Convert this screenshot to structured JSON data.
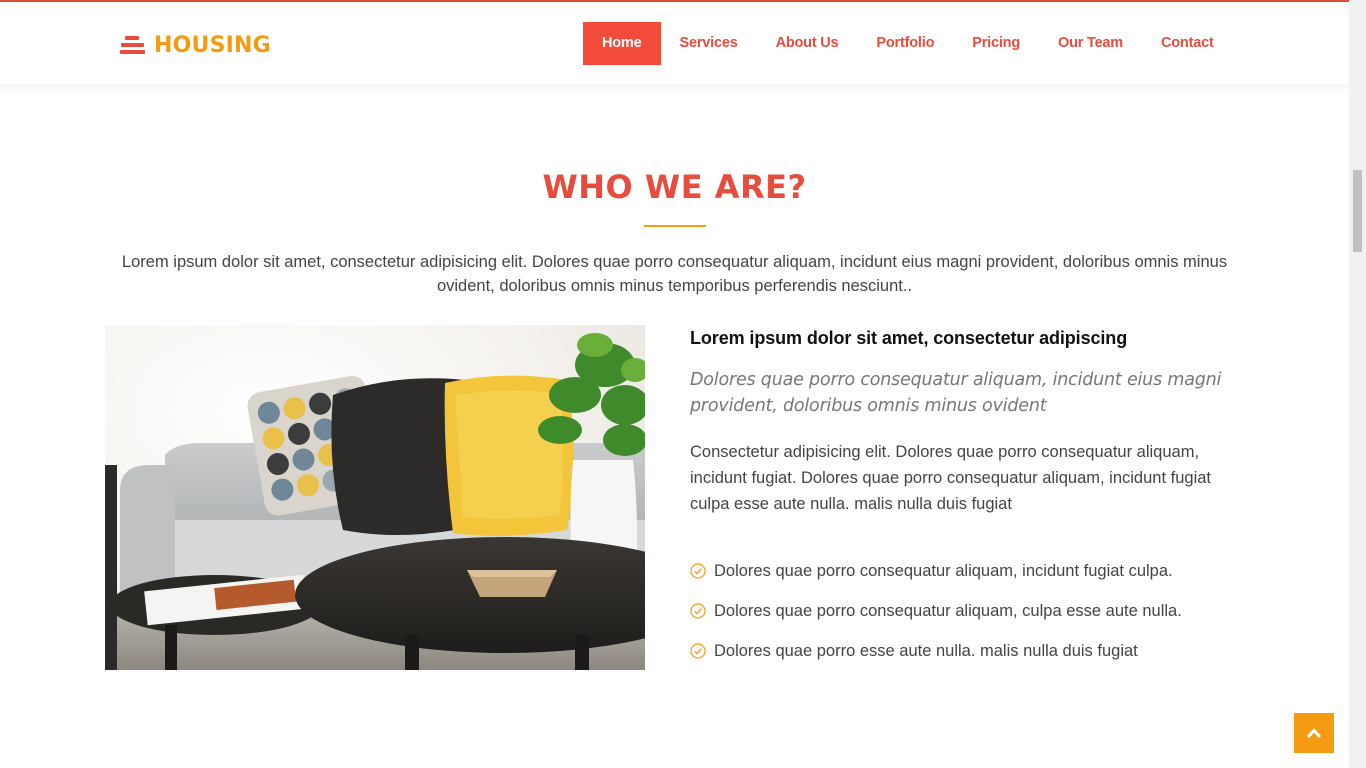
{
  "header": {
    "logo_text": "HOUSING",
    "nav": [
      {
        "label": "Home",
        "active": true
      },
      {
        "label": "Services"
      },
      {
        "label": "About Us"
      },
      {
        "label": "Portfolio"
      },
      {
        "label": "Pricing"
      },
      {
        "label": "Our Team"
      },
      {
        "label": "Contact"
      }
    ]
  },
  "about": {
    "title": "WHO WE ARE?",
    "intro": "Lorem ipsum dolor sit amet, consectetur adipisicing elit. Dolores quae porro consequatur aliquam, incidunt eius magni provident, doloribus omnis minus ovident, doloribus omnis minus temporibus perferendis nesciunt..",
    "heading": "Lorem ipsum dolor sit amet, consectetur adipiscing",
    "lead": "Dolores quae porro consequatur aliquam, incidunt eius magni provident, doloribus omnis minus ovident",
    "body": "Consectetur adipisicing elit. Dolores quae porro consequatur aliquam, incidunt fugiat. Dolores quae porro consequatur aliquam, incidunt fugiat culpa esse aute nulla. malis nulla duis fugiat",
    "checklist": [
      "Dolores quae porro consequatur aliquam, incidunt fugiat culpa.",
      "Dolores quae porro consequatur aliquam, culpa esse aute nulla.",
      "Dolores quae porro esse aute nulla. malis nulla duis fugiat"
    ]
  },
  "icons": {
    "logo": "stacked-bars-icon",
    "check": "check-circle-icon",
    "back_to_top": "chevron-up-icon"
  },
  "colors": {
    "primary": "#e74c3c",
    "accent": "#f39c12"
  }
}
